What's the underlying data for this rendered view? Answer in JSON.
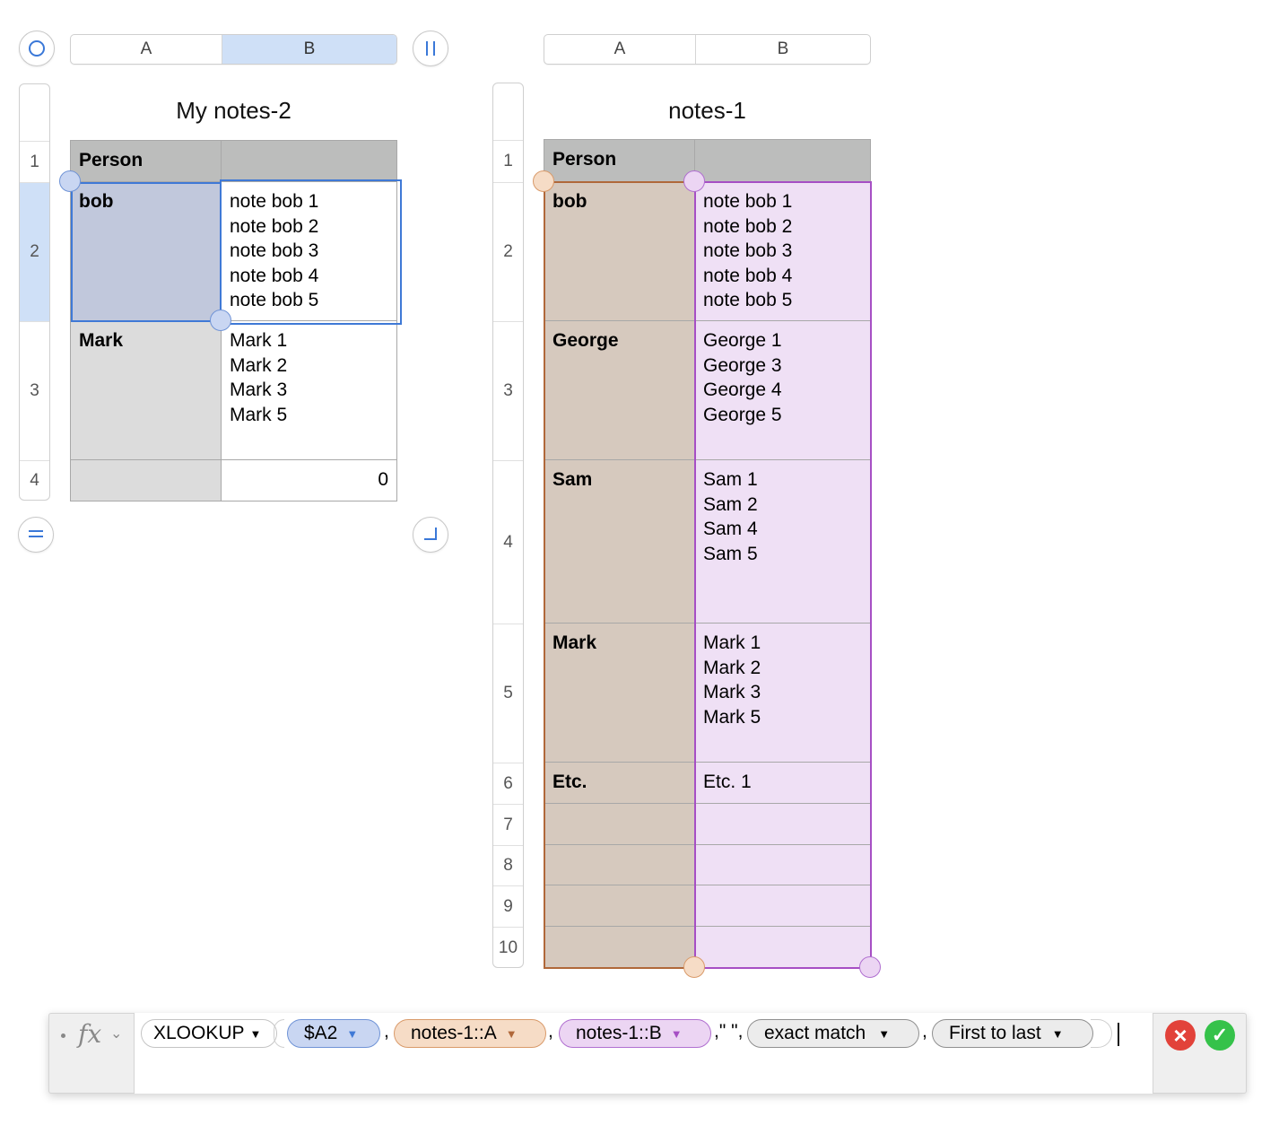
{
  "left_table": {
    "title": "My notes-2",
    "columns": [
      "A",
      "B"
    ],
    "row_numbers": [
      "1",
      "2",
      "3",
      "4"
    ],
    "header": [
      "Person",
      ""
    ],
    "rows": [
      {
        "a": "bob",
        "b": "note bob 1\nnote bob 2\nnote bob 3\nnote bob 4\nnote bob 5"
      },
      {
        "a": "Mark",
        "b": "Mark 1\nMark 2\nMark 3\nMark 5"
      },
      {
        "a": "",
        "b": "0"
      }
    ],
    "selected_column": "B",
    "selected_row": "2"
  },
  "right_table": {
    "title": "notes-1",
    "columns": [
      "A",
      "B"
    ],
    "row_numbers": [
      "1",
      "2",
      "3",
      "4",
      "5",
      "6",
      "7",
      "8",
      "9",
      "10"
    ],
    "header": [
      "Person",
      ""
    ],
    "rows": [
      {
        "a": "bob",
        "b": "note bob 1\nnote bob 2\nnote bob 3\nnote bob 4\nnote bob 5"
      },
      {
        "a": "George",
        "b": "George 1\nGeorge 3\nGeorge 4\nGeorge 5"
      },
      {
        "a": "Sam",
        "b": "Sam 1\nSam 2\nSam 4\nSam 5"
      },
      {
        "a": "Mark",
        "b": "Mark 1\nMark 2\nMark 3\nMark 5"
      },
      {
        "a": "Etc.",
        "b": "Etc. 1"
      },
      {
        "a": "",
        "b": ""
      },
      {
        "a": "",
        "b": ""
      },
      {
        "a": "",
        "b": ""
      },
      {
        "a": "",
        "b": ""
      }
    ]
  },
  "formula_bar": {
    "fx_label": "fx",
    "function": "XLOOKUP",
    "tokens": [
      "$A2",
      "notes-1::A",
      "notes-1::B"
    ],
    "literal": "\" \"",
    "separators": [
      ",",
      ",",
      ",",
      ",",
      ","
    ],
    "match_mode": "exact match",
    "search_mode": "First to last"
  },
  "colors": {
    "selection_blue": "#3f79d6",
    "ref_a2": "#c9d6f2",
    "ref_notes_a": "#f6dcc6",
    "ref_notes_b": "#ecd5f3",
    "cancel_red": "#e2423a",
    "accept_green": "#35c24a"
  }
}
